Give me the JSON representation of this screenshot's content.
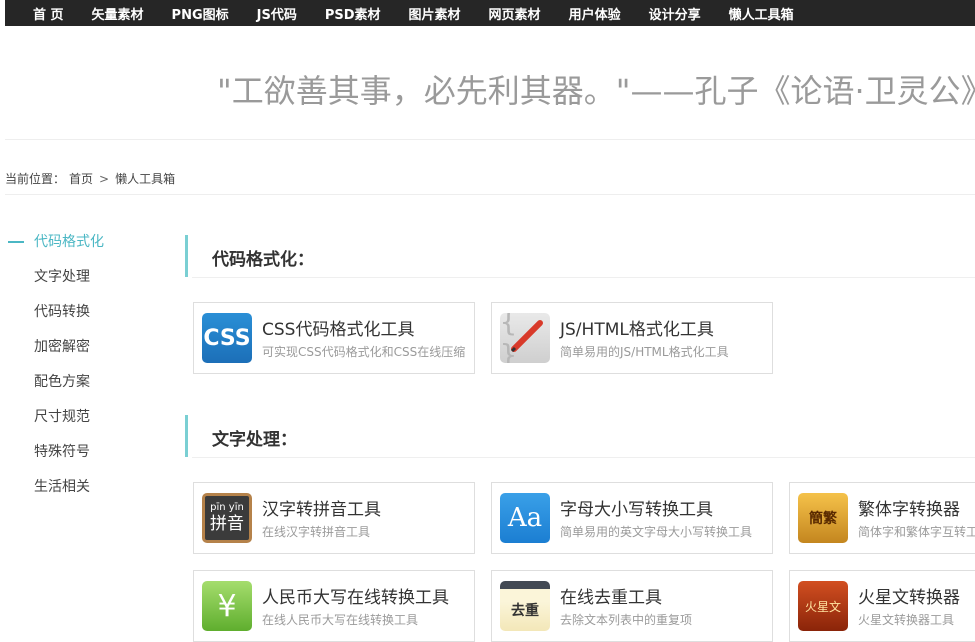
{
  "nav": [
    "首 页",
    "矢量素材",
    "PNG图标",
    "JS代码",
    "PSD素材",
    "图片素材",
    "网页素材",
    "用户体验",
    "设计分享",
    "懒人工具箱"
  ],
  "quote": "\"工欲善其事，必先利其器。\"——孔子《论语·卫灵公》",
  "breadcrumb": {
    "prefix": "当前位置：",
    "home": "首页",
    "sep": ">",
    "current": "懒人工具箱"
  },
  "sidebar": [
    {
      "label": "代码格式化",
      "active": true
    },
    {
      "label": "文字处理"
    },
    {
      "label": "代码转换"
    },
    {
      "label": "加密解密"
    },
    {
      "label": "配色方案"
    },
    {
      "label": "尺寸规范"
    },
    {
      "label": "特殊符号"
    },
    {
      "label": "生活相关"
    }
  ],
  "sections": [
    {
      "title": "代码格式化：",
      "tools": [
        {
          "name": "CSS代码格式化工具",
          "desc": "可实现CSS代码格式化和CSS在线压缩",
          "icon": "css-icon",
          "icon_text": "CSS"
        },
        {
          "name": "JS/HTML格式化工具",
          "desc": "简单易用的JS/HTML格式化工具",
          "icon": "js-html-icon",
          "icon_text": "{ }"
        }
      ]
    },
    {
      "title": "文字处理：",
      "tools": [
        {
          "name": "汉字转拼音工具",
          "desc": "在线汉字转拼音工具",
          "icon": "pinyin-icon",
          "icon_text": "拼音",
          "icon_sub": "pīn yīn"
        },
        {
          "name": "字母大小写转换工具",
          "desc": "简单易用的英文字母大小写转换工具",
          "icon": "letter-case-icon",
          "icon_text": "Aa"
        },
        {
          "name": "繁体字转换器",
          "desc": "简体字和繁体字互转工具",
          "icon": "traditional-chinese-icon",
          "icon_text": "簡繁"
        },
        {
          "name": "人民币大写在线转换工具",
          "desc": "在线人民币大写在线转换工具",
          "icon": "rmb-icon",
          "icon_text": "¥"
        },
        {
          "name": "在线去重工具",
          "desc": "去除文本列表中的重复项",
          "icon": "dedupe-icon",
          "icon_text": "去重"
        },
        {
          "name": "火星文转换器",
          "desc": "火星文转换器工具",
          "icon": "martian-text-icon",
          "icon_text": "火星文"
        }
      ]
    }
  ],
  "colors": {
    "nav_bg": "#262626",
    "accent": "#4bb7c4",
    "section_bar": "#7acfd3"
  }
}
